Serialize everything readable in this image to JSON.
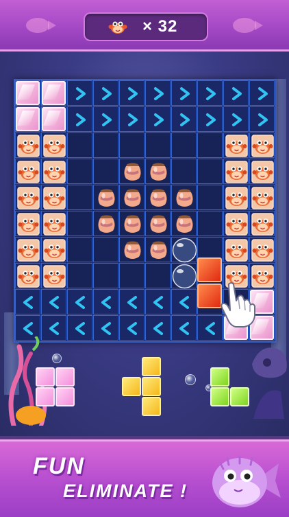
{
  "header": {
    "counter_value": "× 32",
    "counter_icon": "crab-icon"
  },
  "board": {
    "size": 10,
    "rows": [
      [
        "pink",
        "pink",
        "right",
        "right",
        "right",
        "right",
        "right",
        "right",
        "right",
        "right"
      ],
      [
        "pink",
        "pink",
        "right",
        "right",
        "right",
        "right",
        "right",
        "right",
        "right",
        "right"
      ],
      [
        "crab",
        "crab",
        "empty",
        "empty",
        "empty",
        "empty",
        "empty",
        "empty",
        "crab",
        "crab"
      ],
      [
        "crab",
        "crab",
        "empty",
        "empty",
        "jar",
        "jar",
        "empty",
        "empty",
        "crab",
        "crab"
      ],
      [
        "crab",
        "crab",
        "empty",
        "jar",
        "jar",
        "jar",
        "jar",
        "empty",
        "crab",
        "crab"
      ],
      [
        "crab",
        "crab",
        "empty",
        "jar",
        "jar",
        "jar",
        "jar",
        "empty",
        "crab",
        "crab"
      ],
      [
        "crab",
        "crab",
        "empty",
        "empty",
        "jar",
        "jar",
        "bubble",
        "empty",
        "crab",
        "crab"
      ],
      [
        "crab",
        "crab",
        "empty",
        "empty",
        "empty",
        "empty",
        "bubble",
        "empty",
        "crab",
        "crab"
      ],
      [
        "left",
        "left",
        "left",
        "left",
        "left",
        "left",
        "left",
        "empty",
        "empty",
        "pink"
      ],
      [
        "left",
        "left",
        "left",
        "left",
        "left",
        "left",
        "left",
        "left",
        "pink",
        "pink"
      ]
    ]
  },
  "dragging_piece": {
    "color": "red",
    "cells": [
      [
        7,
        8
      ],
      [
        8,
        8
      ]
    ]
  },
  "tray": {
    "pieces": [
      {
        "name": "pink-square-piece",
        "color": "pink",
        "cells": [
          [
            0,
            0
          ],
          [
            1,
            0
          ],
          [
            0,
            1
          ],
          [
            1,
            1
          ]
        ]
      },
      {
        "name": "yellow-t-piece",
        "color": "yellow",
        "cells": [
          [
            1,
            0
          ],
          [
            0,
            1
          ],
          [
            1,
            1
          ],
          [
            1,
            2
          ]
        ]
      },
      {
        "name": "green-s-piece",
        "color": "green",
        "cells": [
          [
            0,
            0
          ],
          [
            0,
            1
          ],
          [
            1,
            1
          ]
        ]
      }
    ]
  },
  "footer": {
    "slogan_line1": "FUN",
    "slogan_line2": "ELIMINATE !"
  },
  "colors": {
    "arrow": "#31c3f2",
    "board_bg": "#1b2868",
    "grid_line": "#3762c8"
  }
}
